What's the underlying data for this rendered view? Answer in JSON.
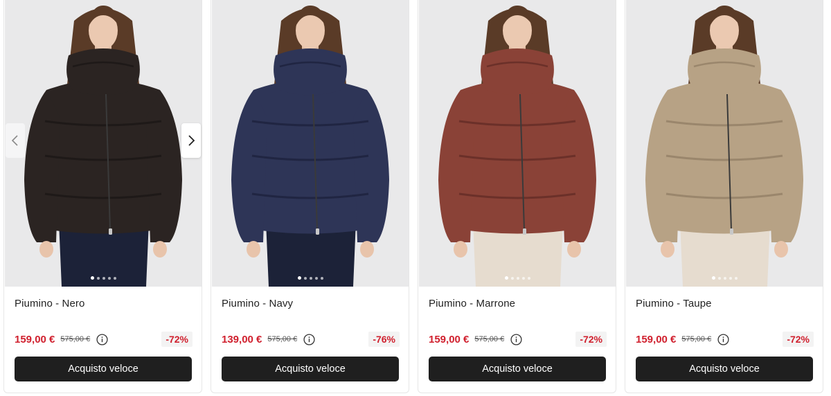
{
  "products": [
    {
      "name": "Piumino - Nero",
      "price": "159,00 €",
      "old_price": "575,00 €",
      "discount": "-72%",
      "button": "Acquisto veloce",
      "jacket_color": "#2b2422",
      "jacket_shade": "#1a1514",
      "pants_color": "#1c2238",
      "active_dot": 0,
      "dot_count": 5,
      "has_prev_arrow": true,
      "has_next_arrow": true
    },
    {
      "name": "Piumino - Navy",
      "price": "139,00 €",
      "old_price": "575,00 €",
      "discount": "-76%",
      "button": "Acquisto veloce",
      "jacket_color": "#2e3557",
      "jacket_shade": "#1b2039",
      "pants_color": "#1c2238",
      "active_dot": 0,
      "dot_count": 5,
      "has_prev_arrow": false,
      "has_next_arrow": false
    },
    {
      "name": "Piumino - Marrone",
      "price": "159,00 €",
      "old_price": "575,00 €",
      "discount": "-72%",
      "button": "Acquisto veloce",
      "jacket_color": "#8a4237",
      "jacket_shade": "#5e2a23",
      "pants_color": "#e6dccf",
      "active_dot": 0,
      "dot_count": 5,
      "has_prev_arrow": false,
      "has_next_arrow": false
    },
    {
      "name": "Piumino - Taupe",
      "price": "159,00 €",
      "old_price": "575,00 €",
      "discount": "-72%",
      "button": "Acquisto veloce",
      "jacket_color": "#b7a285",
      "jacket_shade": "#8d7a61",
      "pants_color": "#e6dccf",
      "active_dot": 0,
      "dot_count": 5,
      "has_prev_arrow": false,
      "has_next_arrow": false
    }
  ],
  "icons": {
    "prev": "chevron-left-icon",
    "next": "chevron-right-icon",
    "info": "info-icon"
  },
  "colors": {
    "price": "#d0202e",
    "button_bg": "#1f1f1f",
    "photo_bg": "#e9e9ea"
  }
}
